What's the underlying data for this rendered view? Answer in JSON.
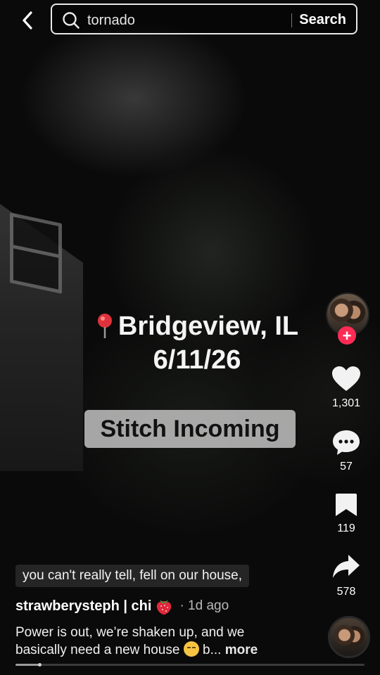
{
  "search": {
    "query": "tornado",
    "button_label": "Search"
  },
  "video": {
    "location_text": "Bridgeview, IL",
    "date_text": "6/11/26",
    "stitch_label": "Stitch Incoming",
    "subtitle": "you can't really tell, fell on our house,"
  },
  "actions": {
    "likes": "1,301",
    "comments": "57",
    "saves": "119",
    "shares": "578"
  },
  "author": {
    "name": "strawberysteph | chi",
    "timestamp": "· 1d ago"
  },
  "caption": {
    "line1": "Power is out, we’re shaken up, and we",
    "line2_start": "basically need a new house",
    "line2_end": " b...",
    "more_label": "more"
  },
  "progress": {
    "fraction": 0.07
  },
  "icons": {
    "back": "chevron-left-icon",
    "search": "search-icon",
    "pin": "location-pin-icon",
    "like": "heart-icon",
    "comment": "comment-bubble-icon",
    "save": "bookmark-icon",
    "share": "share-arrow-icon",
    "emoji": "pensive-face-emoji",
    "strawberry": "strawberry-emoji"
  },
  "colors": {
    "accent": "#fe2c55",
    "background": "#050505"
  }
}
